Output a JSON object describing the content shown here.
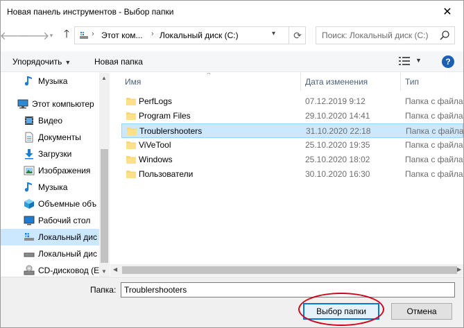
{
  "window": {
    "title": "Новая панель инструментов - Выбор папки",
    "close_glyph": "✕"
  },
  "address": {
    "crumbs": [
      "Этот ком...",
      "Локальный диск (C:)"
    ],
    "search_placeholder": "Поиск: Локальный диск (C:)"
  },
  "toolbar": {
    "organize": "Упорядочить",
    "new_folder": "Новая папка",
    "help": "?"
  },
  "nav": {
    "items": [
      {
        "label": "Музыка",
        "icon": "music-icon"
      },
      {
        "label": "Этот компьютер",
        "icon": "computer-icon"
      },
      {
        "label": "Видео",
        "icon": "video-icon"
      },
      {
        "label": "Документы",
        "icon": "documents-icon"
      },
      {
        "label": "Загрузки",
        "icon": "downloads-icon"
      },
      {
        "label": "Изображения",
        "icon": "pictures-icon"
      },
      {
        "label": "Музыка",
        "icon": "music-icon"
      },
      {
        "label": "Объемные объ",
        "icon": "3d-objects-icon"
      },
      {
        "label": "Рабочий стол",
        "icon": "desktop-icon"
      },
      {
        "label": "Локальный дис",
        "icon": "drive-icon",
        "selected": true
      },
      {
        "label": "Локальный дис",
        "icon": "drive-icon"
      },
      {
        "label": "CD-дисковод (E",
        "icon": "cd-drive-icon"
      }
    ]
  },
  "columns": {
    "name": "Имя",
    "date": "Дата изменения",
    "type": "Тип"
  },
  "files": [
    {
      "name": "PerfLogs",
      "date": "07.12.2019 9:12",
      "type": "Папка с файлами"
    },
    {
      "name": "Program Files",
      "date": "29.10.2020 14:41",
      "type": "Папка с файлами"
    },
    {
      "name": "Troublershooters",
      "date": "31.10.2020 22:18",
      "type": "Папка с файлами",
      "selected": true
    },
    {
      "name": "ViVeTool",
      "date": "25.10.2020 19:35",
      "type": "Папка с файлами"
    },
    {
      "name": "Windows",
      "date": "25.10.2020 18:02",
      "type": "Папка с файлами"
    },
    {
      "name": "Пользователи",
      "date": "30.10.2020 16:30",
      "type": "Папка с файлами"
    }
  ],
  "footer": {
    "folder_label": "Папка:",
    "folder_value": "Troublershooters",
    "select_button": "Выбор папки",
    "cancel_button": "Отмена"
  },
  "colors": {
    "accent": "#0078d7",
    "selection": "#cce8ff",
    "folder": "#f8d775",
    "highlight_ring": "#d0021b"
  }
}
